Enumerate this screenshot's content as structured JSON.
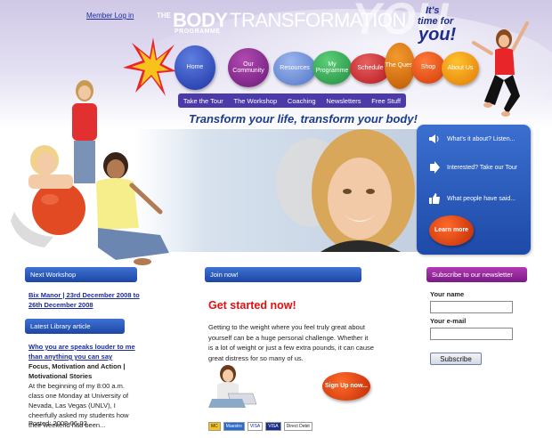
{
  "header": {
    "member_login": "Member Log in",
    "logo": {
      "the": "THE",
      "body": "BODY",
      "transformation": "TRANSFORMATION",
      "programme": "PROGRAMME"
    },
    "tagline": {
      "its": "It's",
      "time_for": "time for",
      "you": "you!",
      "watermark": "YOU"
    }
  },
  "nav": {
    "items": [
      {
        "label": "Home"
      },
      {
        "label": "Our Community"
      },
      {
        "label": "Resources"
      },
      {
        "label": "My Programme"
      },
      {
        "label": "Schedule"
      },
      {
        "label": "The Quest"
      },
      {
        "label": "Shop"
      },
      {
        "label": "About Us"
      }
    ]
  },
  "subnav": {
    "items": [
      {
        "label": "Take the Tour"
      },
      {
        "label": "The Workshop"
      },
      {
        "label": "Coaching"
      },
      {
        "label": "Newsletters"
      },
      {
        "label": "Free Stuff"
      }
    ]
  },
  "slogan": "Transform your life, transform your body!",
  "info_panel": {
    "items": [
      {
        "label": "What's it about? Listen...",
        "icon": "speaker-icon"
      },
      {
        "label": "Interested? Take our Tour",
        "icon": "arrow-icon"
      },
      {
        "label": "What people have said...",
        "icon": "thumbs-up-icon"
      }
    ],
    "learn_more": "Learn more"
  },
  "left_col": {
    "next_workshop_title": "Next Workshop",
    "workshop_link": "Bix Manor | 23rd December 2008 to 26th December 2008",
    "library_title": "Latest Library article",
    "article_link": "Who you are speaks louder to me than anything you can say",
    "article_category": "Focus, Motivation and Action | Motivational Stories",
    "article_excerpt": "At the beginning of my 8:00 a.m. class one Monday at University of Nevada, Las Vegas (UNLV), I cheerfully asked my students how their weekend had been...",
    "posted": "Posted: 2008-06-02"
  },
  "mid_col": {
    "join_title": "Join now!",
    "get_started": "Get started now!",
    "body": "Getting to the weight where you feel truly great about yourself can be a huge personal challenge. Whether it is a lot of weight or just a few extra pounds, it can cause great distress for so many of us.",
    "signup": "Sign Up now...",
    "payments": [
      "MC",
      "Maestro",
      "VISA",
      "VISA",
      "Direct Debit"
    ]
  },
  "right_col": {
    "newsletter_title": "Subscribe to our newsletter",
    "name_label": "Your name",
    "email_label": "Your e-mail",
    "subscribe": "Subscribe"
  },
  "colors": {
    "accent_blue": "#1e4aa8",
    "accent_purple": "#7a1a86",
    "cta_red": "#e01010",
    "nav_purple": "#4b3aa8"
  }
}
